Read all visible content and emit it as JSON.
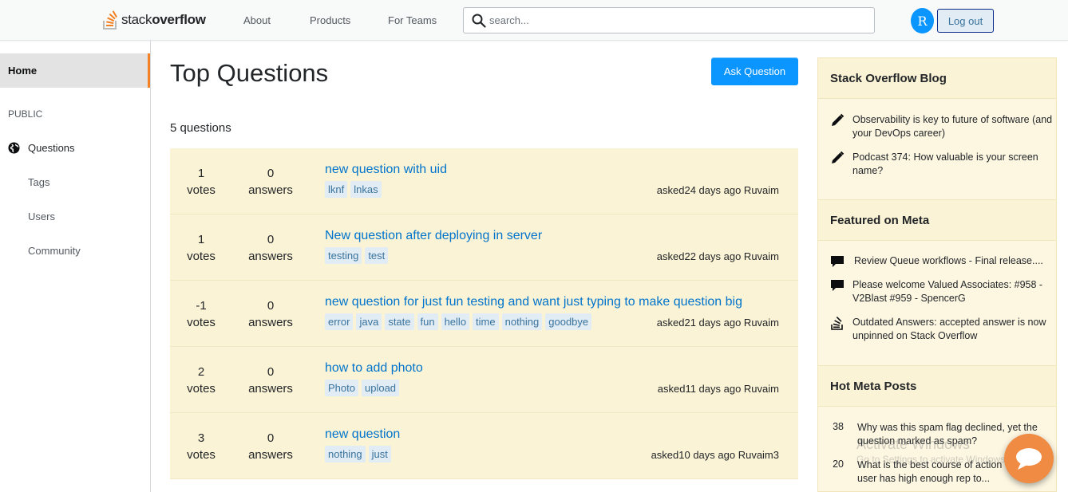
{
  "header": {
    "logo_text_light": "stack",
    "logo_text_bold": "overflow",
    "nav": [
      "About",
      "Products",
      "For Teams"
    ],
    "search_placeholder": "search...",
    "avatar_letter": "R",
    "logout_label": "Log out"
  },
  "sidebar": {
    "home": "Home",
    "public": "PUBLIC",
    "questions": "Questions",
    "tags": "Tags",
    "users": "Users",
    "community": "Community"
  },
  "main": {
    "title": "Top Questions",
    "ask_label": "Ask Question",
    "count_label": "5 questions",
    "questions": [
      {
        "votes": "1",
        "votes_label": "votes",
        "answers": "0",
        "answers_label": "answers",
        "title": "new question with uid",
        "tags": [
          "lknf",
          "lnkas"
        ],
        "asked": "asked24 days ago Ruvaim"
      },
      {
        "votes": "1",
        "votes_label": "votes",
        "answers": "0",
        "answers_label": "answers",
        "title": "New question after deploying in server",
        "tags": [
          "testing",
          "test"
        ],
        "asked": "asked22 days ago Ruvaim"
      },
      {
        "votes": "-1",
        "votes_label": "votes",
        "answers": "0",
        "answers_label": "answers",
        "title": "new question for just fun testing and want just typing to make question big",
        "tags": [
          "error",
          "java",
          "state",
          "fun",
          "hello",
          "time",
          "nothing",
          "goodbye"
        ],
        "asked": "asked21 days ago Ruvaim"
      },
      {
        "votes": "2",
        "votes_label": "votes",
        "answers": "0",
        "answers_label": "answers",
        "title": "how to add photo",
        "tags": [
          "Photo",
          "upload"
        ],
        "asked": "asked11 days ago Ruvaim"
      },
      {
        "votes": "3",
        "votes_label": "votes",
        "answers": "0",
        "answers_label": "answers",
        "title": "new question",
        "tags": [
          "nothing",
          "just"
        ],
        "asked": "asked10 days ago Ruvaim3"
      }
    ]
  },
  "right": {
    "blog_title": "Stack Overflow Blog",
    "blog_items": [
      "Observability is key to future of software (and your DevOps career)",
      "Podcast 374: How valuable is your screen name?"
    ],
    "meta_title": "Featured on Meta",
    "meta_items": [
      "Review Queue workflows - Final release....",
      "Please welcome Valued Associates: #958 - V2Blast #959 - SpencerG",
      "Outdated Answers: accepted answer is now unpinned on Stack Overflow"
    ],
    "hot_title": "Hot Meta Posts",
    "hot_items": [
      {
        "num": "38",
        "text": "Why was this spam flag declined, yet the question marked as spam?"
      },
      {
        "num": "20",
        "text": "What is the best course of action when a user has high enough rep to..."
      }
    ]
  },
  "overlay": {
    "watermark": "Activate Windows",
    "watermark_sub": "Go to Settings to activate Windows."
  },
  "colors": {
    "accent_orange": "#f48225",
    "primary_blue": "#0a95ff",
    "question_bg": "#fbf3d5",
    "link_blue": "#0074cc"
  }
}
